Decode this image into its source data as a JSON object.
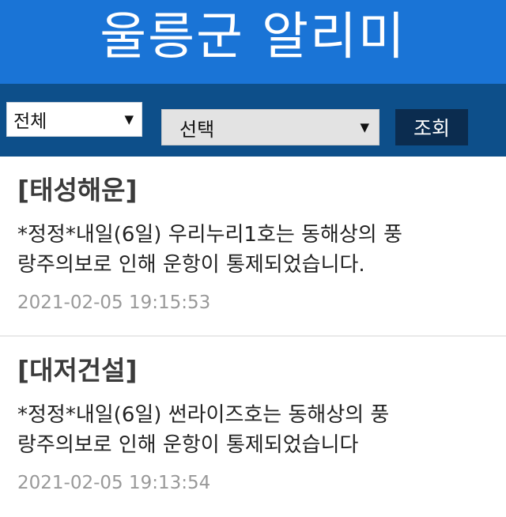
{
  "header": {
    "title": "울릉군 알리미"
  },
  "filters": {
    "category": {
      "selected": "전체",
      "arrow_icon": "caret-down-icon"
    },
    "choice": {
      "selected": "선택",
      "arrow_icon": "caret-down-icon"
    },
    "search_label": "조회"
  },
  "notices": [
    {
      "company": "[태성해운]",
      "line1": "*정정*내일(6일) 우리누리1호는 동해상의 풍",
      "line2": "랑주의보로 인해 운항이 통제되었습니다.",
      "timestamp": "2021-02-05 19:15:53"
    },
    {
      "company": "[대저건설]",
      "line1": "*정정*내일(6일) 썬라이즈호는 동해상의 풍",
      "line2": "랑주의보로 인해 운항이 통제되었습니다",
      "timestamp": "2021-02-05 19:13:54"
    }
  ],
  "colors": {
    "header_bg": "#1a74d6",
    "filter_bar_bg": "#0d4f8a",
    "button_bg": "#0b2c4f"
  }
}
